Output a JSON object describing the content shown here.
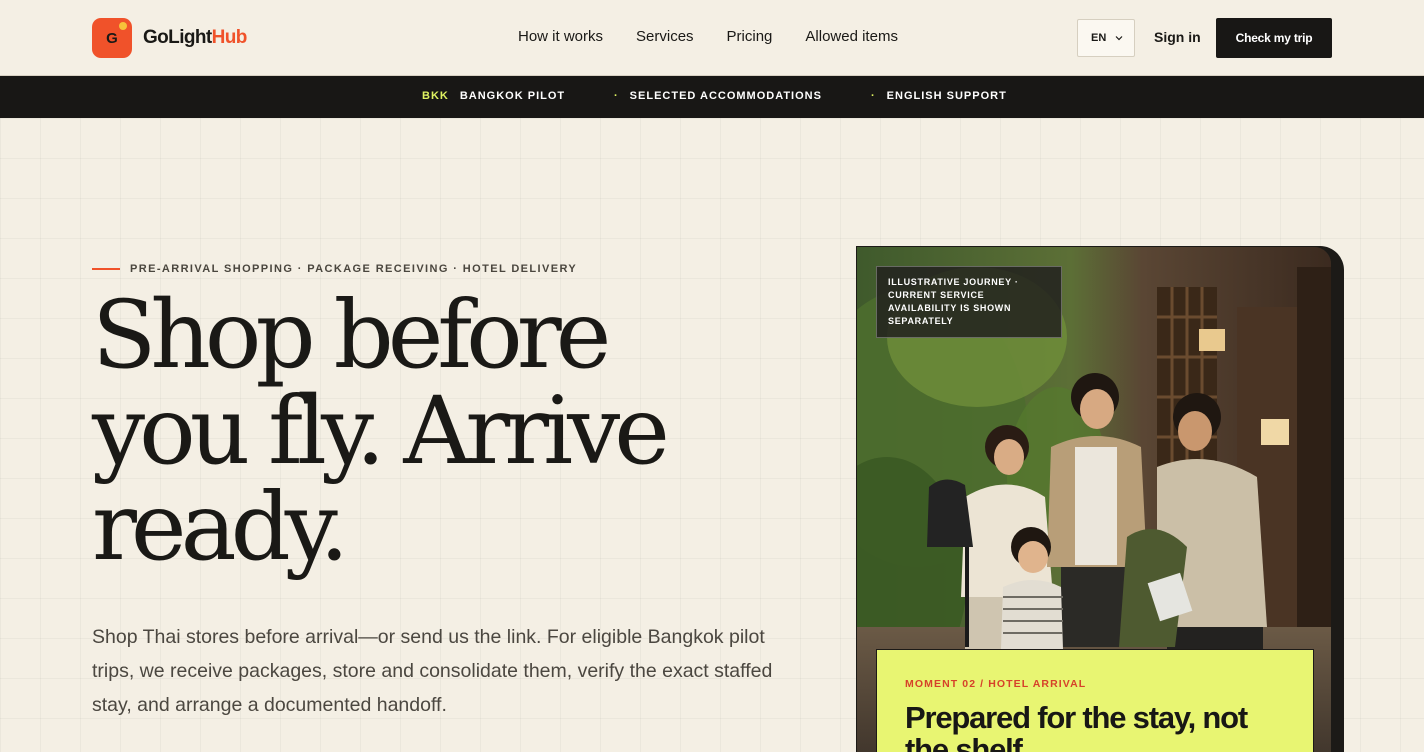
{
  "brand": {
    "logo_letter": "G",
    "name_part1": "GoLight",
    "name_part2": "Hub",
    "accent_color": "#f0522a"
  },
  "nav": {
    "items": [
      {
        "label": "How it works"
      },
      {
        "label": "Services"
      },
      {
        "label": "Pricing"
      },
      {
        "label": "Allowed items"
      }
    ]
  },
  "header": {
    "language": "EN",
    "sign_in": "Sign in",
    "cta": "Check my trip"
  },
  "ticker": {
    "code": "BKK",
    "items": [
      "BANGKOK PILOT",
      "SELECTED ACCOMMODATIONS",
      "ENGLISH SUPPORT"
    ],
    "dot": "·"
  },
  "hero": {
    "eyebrow": "PRE-ARRIVAL SHOPPING · PACKAGE RECEIVING · HOTEL DELIVERY",
    "headline_lines": [
      "Shop before",
      "you fly. Arrive",
      "ready."
    ],
    "lede": "Shop Thai stores before arrival—or send us the link. For eligible Bangkok pilot trips, we receive packages, store and consolidate them, verify the exact staffed stay, and arrange a documented handoff."
  },
  "photo_card": {
    "badge": "ILLUSTRATIVE JOURNEY · CURRENT SERVICE AVAILABILITY IS SHOWN SEPARATELY",
    "moment_label": "MOMENT 02 / HOTEL ARRIVAL",
    "moment_title": "Prepared for the stay, not the shelf."
  },
  "colors": {
    "background": "#f4efe4",
    "dark": "#181715",
    "lime": "#e8f572",
    "ticker_accent": "#dff261"
  }
}
